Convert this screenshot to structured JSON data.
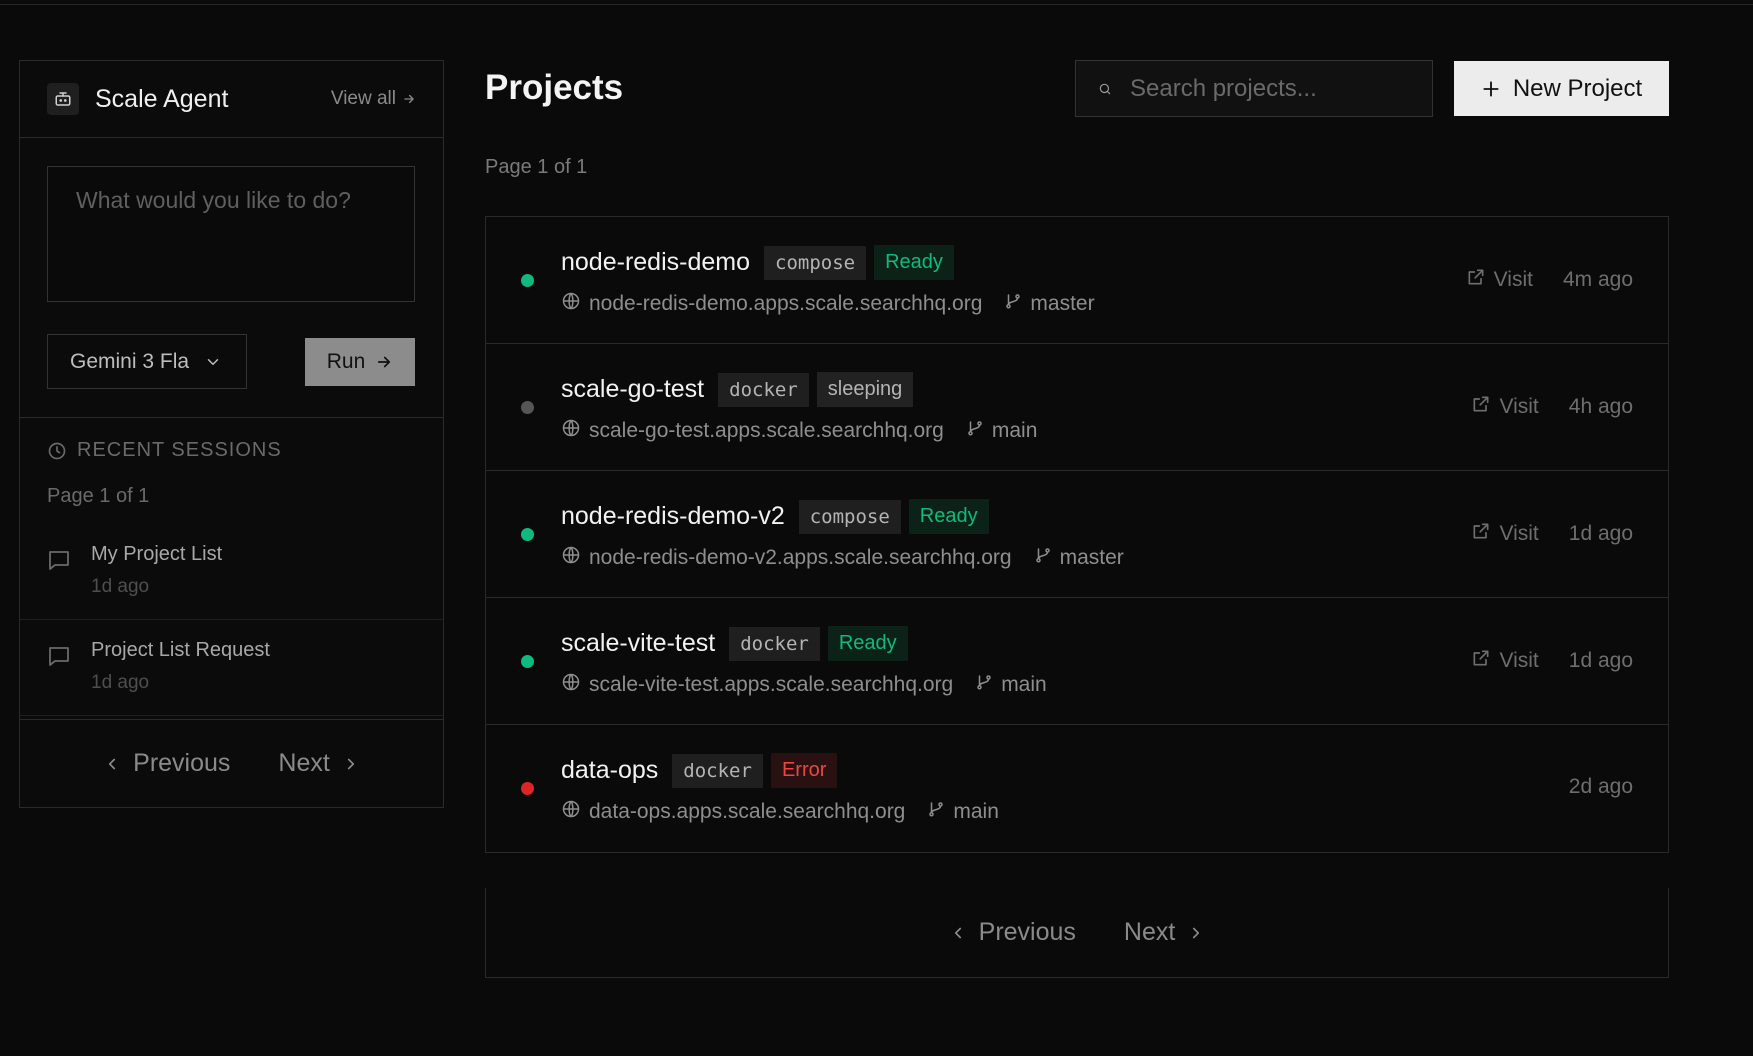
{
  "colors": {
    "ready": "#10b981",
    "sleeping": "#555555",
    "error": "#dc2626",
    "accent_button": "#ececec"
  },
  "agent": {
    "title": "Scale Agent",
    "view_all": "View all",
    "prompt_placeholder": "What would you like to do?",
    "model": "Gemini 3 Fla",
    "run_label": "Run",
    "recent_heading": "RECENT SESSIONS",
    "page_info": "Page 1 of 1",
    "sessions": [
      {
        "title": "My Project List",
        "time": "1d ago"
      },
      {
        "title": "Project List Request",
        "time": "1d ago"
      }
    ],
    "prev_label": "Previous",
    "next_label": "Next"
  },
  "main": {
    "title": "Projects",
    "search_placeholder": "Search projects...",
    "new_project_label": "New Project",
    "page_info": "Page 1 of 1",
    "prev_label": "Previous",
    "next_label": "Next",
    "projects": [
      {
        "name": "node-redis-demo",
        "type": "compose",
        "status": "Ready",
        "status_kind": "ready",
        "url": "node-redis-demo.apps.scale.searchhq.org",
        "branch": "master",
        "visit": "Visit",
        "time": "4m ago"
      },
      {
        "name": "scale-go-test",
        "type": "docker",
        "status": "sleeping",
        "status_kind": "sleeping",
        "url": "scale-go-test.apps.scale.searchhq.org",
        "branch": "main",
        "visit": "Visit",
        "time": "4h ago"
      },
      {
        "name": "node-redis-demo-v2",
        "type": "compose",
        "status": "Ready",
        "status_kind": "ready",
        "url": "node-redis-demo-v2.apps.scale.searchhq.org",
        "branch": "master",
        "visit": "Visit",
        "time": "1d ago"
      },
      {
        "name": "scale-vite-test",
        "type": "docker",
        "status": "Ready",
        "status_kind": "ready",
        "url": "scale-vite-test.apps.scale.searchhq.org",
        "branch": "main",
        "visit": "Visit",
        "time": "1d ago"
      },
      {
        "name": "data-ops",
        "type": "docker",
        "status": "Error",
        "status_kind": "error",
        "url": "data-ops.apps.scale.searchhq.org",
        "branch": "main",
        "visit": "",
        "time": "2d ago"
      }
    ]
  }
}
